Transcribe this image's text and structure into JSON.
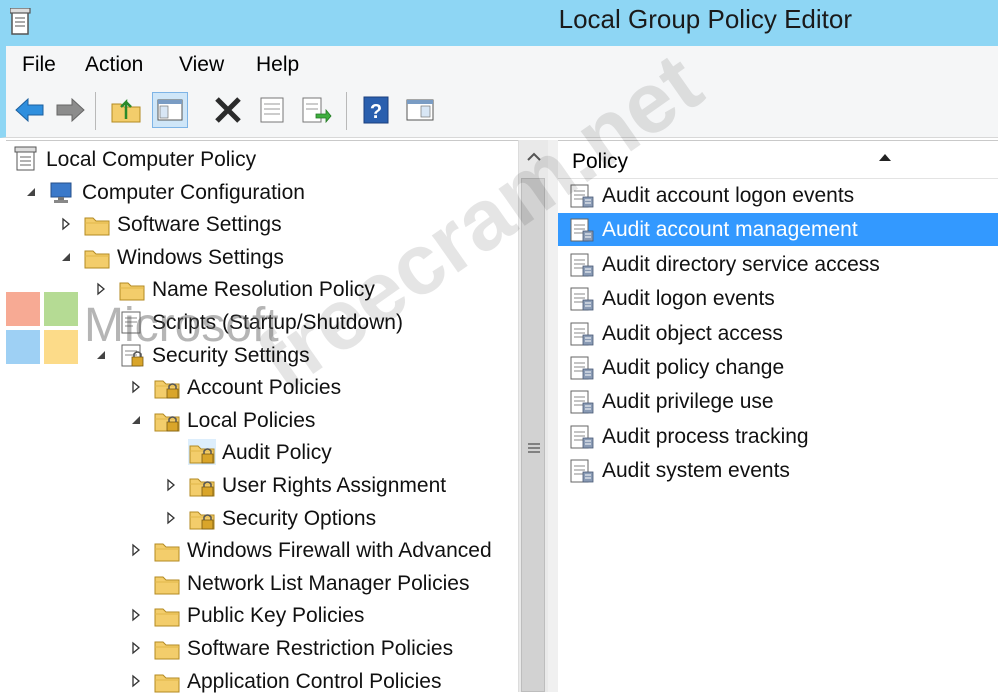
{
  "window": {
    "title": "Local Group Policy Editor"
  },
  "menu": {
    "items": [
      "File",
      "Action",
      "View",
      "Help"
    ]
  },
  "toolbar": {
    "buttons": [
      "back-arrow-icon",
      "forward-arrow-icon",
      "up-folder-icon",
      "show-hide-tree-icon",
      "delete-icon",
      "properties-icon",
      "export-list-icon",
      "help-icon",
      "action-pane-icon"
    ]
  },
  "tree": {
    "items": [
      {
        "label": "Local Computer Policy",
        "level": 0,
        "expander": "none",
        "icon": "policy-scroll-icon"
      },
      {
        "label": "Computer Configuration",
        "level": 1,
        "expander": "expanded",
        "icon": "computer-icon"
      },
      {
        "label": "Software Settings",
        "level": 2,
        "expander": "collapsed",
        "icon": "folder-icon"
      },
      {
        "label": "Windows Settings",
        "level": 2,
        "expander": "expanded",
        "icon": "folder-icon"
      },
      {
        "label": "Name Resolution Policy",
        "level": 3,
        "expander": "collapsed",
        "icon": "folder-icon"
      },
      {
        "label": "Scripts (Startup/Shutdown)",
        "level": 3,
        "expander": "none",
        "icon": "scripts-icon"
      },
      {
        "label": "Security Settings",
        "level": 3,
        "expander": "expanded",
        "icon": "security-settings-icon"
      },
      {
        "label": "Account Policies",
        "level": 4,
        "expander": "collapsed",
        "icon": "locked-folder-icon"
      },
      {
        "label": "Local Policies",
        "level": 4,
        "expander": "expanded",
        "icon": "locked-folder-icon"
      },
      {
        "label": "Audit Policy",
        "level": 5,
        "expander": "none",
        "icon": "locked-folder-icon",
        "selected": true
      },
      {
        "label": "User Rights Assignment",
        "level": 5,
        "expander": "collapsed",
        "icon": "locked-folder-icon"
      },
      {
        "label": "Security Options",
        "level": 5,
        "expander": "collapsed",
        "icon": "locked-folder-icon"
      },
      {
        "label": "Windows Firewall with Advanced",
        "level": 4,
        "expander": "collapsed",
        "icon": "folder-icon"
      },
      {
        "label": "Network List Manager Policies",
        "level": 4,
        "expander": "none",
        "icon": "folder-icon"
      },
      {
        "label": "Public Key Policies",
        "level": 4,
        "expander": "collapsed",
        "icon": "folder-icon"
      },
      {
        "label": "Software Restriction Policies",
        "level": 4,
        "expander": "collapsed",
        "icon": "folder-icon"
      },
      {
        "label": "Application Control Policies",
        "level": 4,
        "expander": "collapsed",
        "icon": "folder-icon"
      }
    ]
  },
  "list": {
    "column_header": "Policy",
    "items": [
      {
        "label": "Audit account logon events"
      },
      {
        "label": "Audit account management",
        "selected": true
      },
      {
        "label": "Audit directory service access"
      },
      {
        "label": "Audit logon events"
      },
      {
        "label": "Audit object access"
      },
      {
        "label": "Audit policy change"
      },
      {
        "label": "Audit privilege use"
      },
      {
        "label": "Audit process tracking"
      },
      {
        "label": "Audit system events"
      }
    ]
  },
  "watermarks": {
    "site": "freecram.net",
    "brand": "Microsoft"
  },
  "colors": {
    "title_bar": "#8ed6f4",
    "selection": "#3399ff",
    "folder": "#f3cd6b"
  }
}
